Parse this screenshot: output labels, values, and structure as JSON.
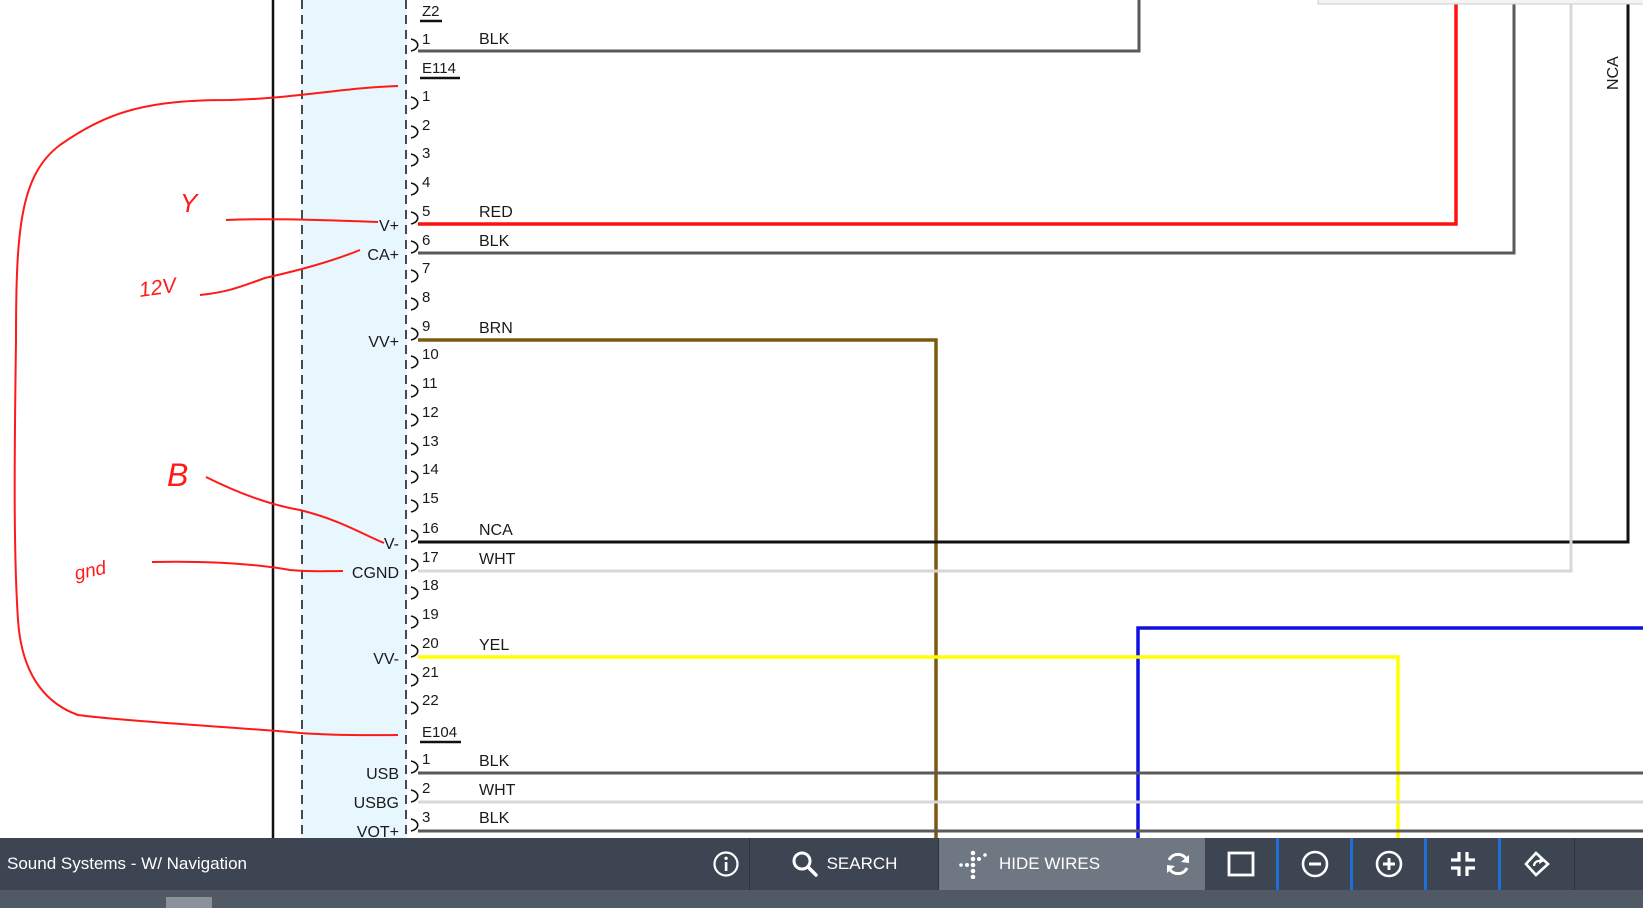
{
  "diagram": {
    "connectors": [
      {
        "id": "Z2",
        "pins": [
          {
            "num": "1",
            "color": "BLK"
          }
        ]
      },
      {
        "id": "E114",
        "pins": [
          {
            "num": "1"
          },
          {
            "num": "2"
          },
          {
            "num": "3"
          },
          {
            "num": "4"
          },
          {
            "num": "5",
            "func": "V+",
            "color": "RED"
          },
          {
            "num": "6",
            "func": "CA+",
            "color": "BLK"
          },
          {
            "num": "7"
          },
          {
            "num": "8"
          },
          {
            "num": "9",
            "func": "VV+",
            "color": "BRN"
          },
          {
            "num": "10"
          },
          {
            "num": "11"
          },
          {
            "num": "12"
          },
          {
            "num": "13"
          },
          {
            "num": "14"
          },
          {
            "num": "15"
          },
          {
            "num": "16",
            "func": "V-",
            "color": "NCA"
          },
          {
            "num": "17",
            "func": "CGND",
            "color": "WHT"
          },
          {
            "num": "18"
          },
          {
            "num": "19"
          },
          {
            "num": "20",
            "func": "VV-",
            "color": "YEL"
          },
          {
            "num": "21"
          },
          {
            "num": "22"
          }
        ]
      },
      {
        "id": "E104",
        "pins": [
          {
            "num": "1",
            "func": "USB",
            "color": "BLK"
          },
          {
            "num": "2",
            "func": "USBG",
            "color": "WHT"
          },
          {
            "num": "3",
            "func": "VOT+",
            "color": "BLK"
          }
        ]
      }
    ],
    "side_label": "NCA",
    "annotations": [
      "Y",
      "12V",
      "B",
      "gnd"
    ],
    "wire_colors": {
      "RED": "#ff1010",
      "BLK": "#5a5a5a",
      "BRN": "#7a5a10",
      "NCA": "#111111",
      "WHT": "#d8d8d8",
      "YEL": "#ffff00",
      "BLUE": "#1010e0",
      "HAND": "#ff1a1a"
    }
  },
  "toolbar": {
    "title": "Sound Systems - W/ Navigation",
    "info_icon": "info-icon",
    "search_label": "SEARCH",
    "hide_wires_label": "HIDE WIRES",
    "icons": [
      "square-icon",
      "zoom-out-icon",
      "zoom-in-icon",
      "collapse-icon",
      "rotate-icon"
    ]
  }
}
